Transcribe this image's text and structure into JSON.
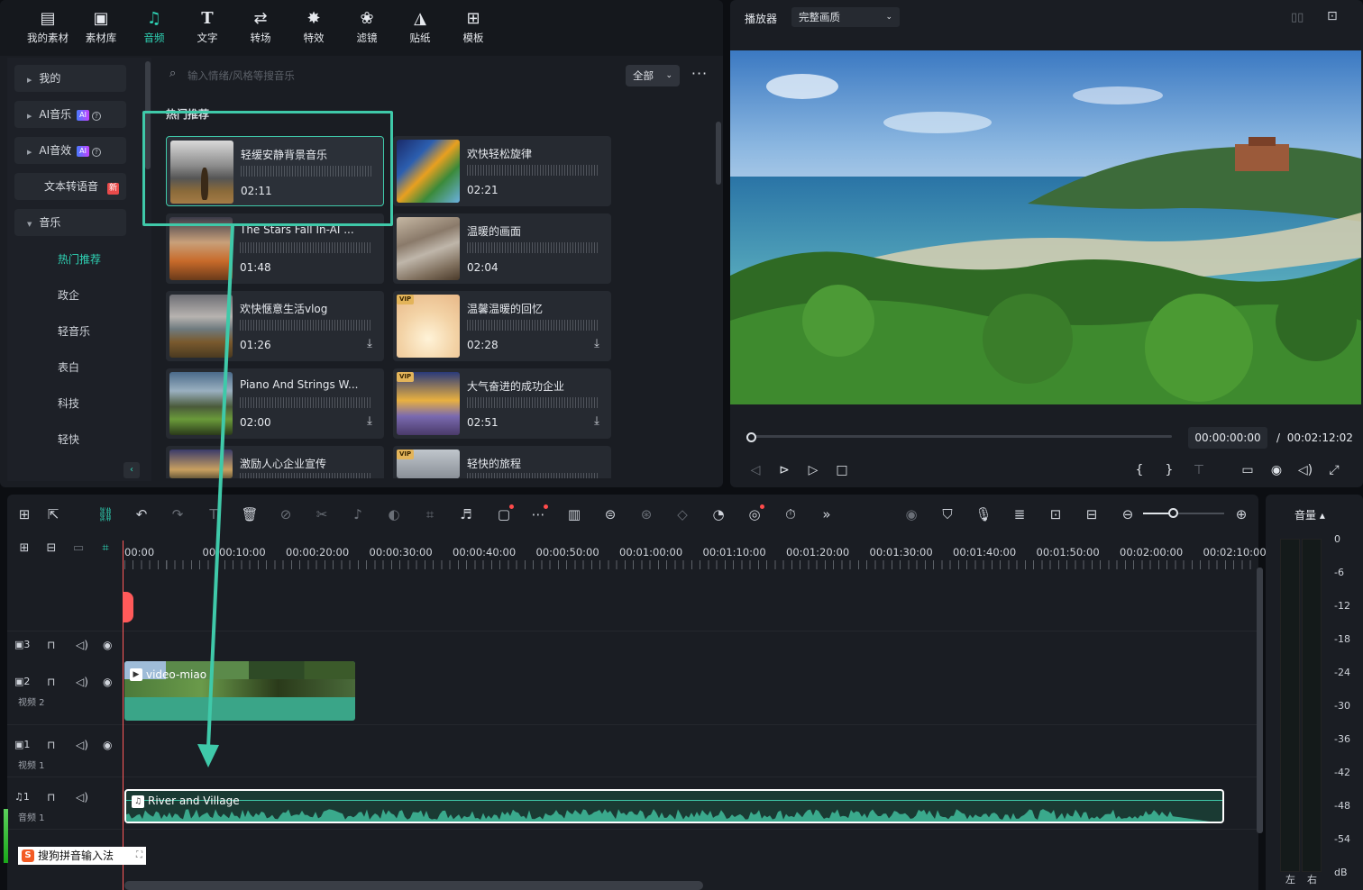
{
  "toolbar_tabs": [
    {
      "label": "我的素材",
      "icon": "my-media-icon",
      "glyph": "🖾"
    },
    {
      "label": "素材库",
      "icon": "stock-media-icon",
      "glyph": "▣"
    },
    {
      "label": "音频",
      "icon": "music-note-icon",
      "glyph": "♫"
    },
    {
      "label": "文字",
      "icon": "text-icon",
      "glyph": "T"
    },
    {
      "label": "转场",
      "icon": "transition-icon",
      "glyph": "⇄"
    },
    {
      "label": "特效",
      "icon": "effects-icon",
      "glyph": "✸"
    },
    {
      "label": "滤镜",
      "icon": "filter-icon",
      "glyph": "❀"
    },
    {
      "label": "贴纸",
      "icon": "sticker-icon",
      "glyph": "◮"
    },
    {
      "label": "模板",
      "icon": "template-icon",
      "glyph": "⊞"
    }
  ],
  "active_tab": "音频",
  "sidebar": {
    "items": [
      {
        "label": "我的"
      },
      {
        "label": "AI音乐",
        "badge": "AI"
      },
      {
        "label": "AI音效",
        "badge": "AI"
      },
      {
        "label": "文本转语音",
        "badge": "新"
      },
      {
        "label": "音乐"
      }
    ],
    "subitems": [
      "热门推荐",
      "政企",
      "轻音乐",
      "表白",
      "科技",
      "轻快"
    ],
    "active_subitem": "热门推荐"
  },
  "search": {
    "placeholder": "输入情绪/风格等搜音乐",
    "filter": "全部",
    "more": "···"
  },
  "section_title": "热门推荐",
  "music_cards": [
    {
      "title": "轻缓安静背景音乐",
      "duration": "02:11",
      "vip": false,
      "download": false
    },
    {
      "title": "欢快轻松旋律",
      "duration": "02:21",
      "vip": false,
      "download": false
    },
    {
      "title": "The Stars Fall In-AI ...",
      "duration": "01:48",
      "vip": false,
      "download": false
    },
    {
      "title": "温暖的画面",
      "duration": "02:04",
      "vip": false,
      "download": false
    },
    {
      "title": "欢快惬意生活vlog",
      "duration": "01:26",
      "vip": false,
      "download": true
    },
    {
      "title": "温馨温暖的回忆",
      "duration": "02:28",
      "vip": true,
      "download": true
    },
    {
      "title": "Piano And Strings W...",
      "duration": "02:00",
      "vip": false,
      "download": true
    },
    {
      "title": "大气奋进的成功企业",
      "duration": "02:51",
      "vip": true,
      "download": true
    },
    {
      "title": "激励人心企业宣传",
      "duration": "",
      "vip": false,
      "download": false
    },
    {
      "title": "轻快的旅程",
      "duration": "",
      "vip": true,
      "download": false
    }
  ],
  "vip_label": "VIP",
  "player": {
    "title": "播放器",
    "quality": "完整画质",
    "current_time": "00:00:00:00",
    "separator": "/",
    "total_time": "00:02:12:02",
    "progress": 0
  },
  "timeline": {
    "ruler": [
      "00:00",
      "00:00:10:00",
      "00:00:20:00",
      "00:00:30:00",
      "00:00:40:00",
      "00:00:50:00",
      "00:01:00:00",
      "00:01:10:00",
      "00:01:20:00",
      "00:01:30:00",
      "00:01:40:00",
      "00:01:50:00",
      "00:02:00:00",
      "00:02:10:00"
    ],
    "tracks": [
      {
        "num": "3",
        "name": ""
      },
      {
        "num": "2",
        "name": "视频 2"
      },
      {
        "num": "1",
        "name": "视频 1"
      },
      {
        "num": "1",
        "name": "音频 1"
      }
    ],
    "video_clip": "video-miao",
    "audio_clip": "River and Village",
    "zoom_level": 0.38
  },
  "meter": {
    "title": "音量 ▴",
    "scale": [
      "0",
      "-6",
      "-12",
      "-18",
      "-24",
      "-30",
      "-36",
      "-42",
      "-48",
      "-54",
      "dB"
    ],
    "left": "左",
    "right": "右"
  },
  "ime": {
    "label": "搜狗拼音输入法",
    "logo": "S"
  },
  "colors": {
    "accent": "#2fd3b5",
    "playhead": "#ff5a5a",
    "highlight": "#3fc9a9"
  }
}
